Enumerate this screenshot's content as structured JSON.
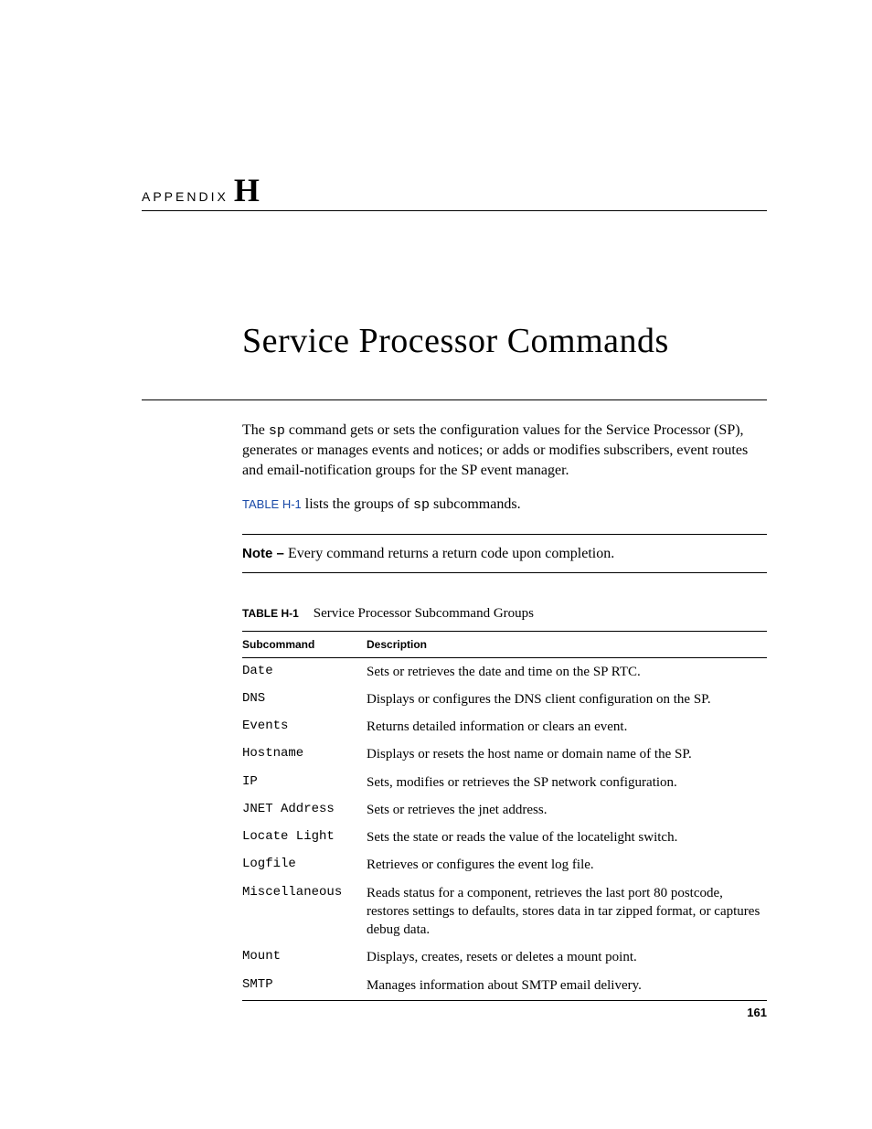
{
  "appendix": {
    "label": "APPENDIX",
    "letter": "H"
  },
  "title": "Service Processor Commands",
  "intro": {
    "p1_a": "The ",
    "p1_code": "sp",
    "p1_b": " command gets or sets the configuration values for the Service Processor (SP), generates or manages events and notices; or adds or modifies subscribers, event routes and email-notification groups for the SP event manager.",
    "p2_ref": "TABLE H-1",
    "p2_a": " lists the groups of ",
    "p2_code": "sp",
    "p2_b": " subcommands."
  },
  "note": {
    "label": "Note – ",
    "text": "Every command returns a return code upon completion."
  },
  "table": {
    "label": "TABLE H-1",
    "caption": "Service Processor Subcommand Groups",
    "headers": {
      "sub": "Subcommand",
      "desc": "Description"
    },
    "rows": [
      {
        "sub": "Date",
        "desc": "Sets or retrieves the date and time on the SP RTC."
      },
      {
        "sub": "DNS",
        "desc": "Displays or configures the DNS client configuration on the SP."
      },
      {
        "sub": "Events",
        "desc": "Returns detailed information or clears an event."
      },
      {
        "sub": "Hostname",
        "desc": "Displays or resets the host name or domain name of the SP."
      },
      {
        "sub": "IP",
        "desc": "Sets, modifies or retrieves the SP network configuration."
      },
      {
        "sub": "JNET Address",
        "desc": "Sets or retrieves the jnet address."
      },
      {
        "sub": "Locate Light",
        "desc": "Sets the state or reads the value of the locatelight switch."
      },
      {
        "sub": "Logfile",
        "desc": "Retrieves or configures the event log file."
      },
      {
        "sub": "Miscellaneous",
        "desc": "Reads status for a component, retrieves the last port 80 postcode, restores settings to defaults, stores data in tar zipped format, or captures debug data."
      },
      {
        "sub": "Mount",
        "desc": "Displays, creates, resets or deletes a mount point."
      },
      {
        "sub": "SMTP",
        "desc": "Manages information about SMTP email delivery."
      }
    ]
  },
  "pageNumber": "161"
}
